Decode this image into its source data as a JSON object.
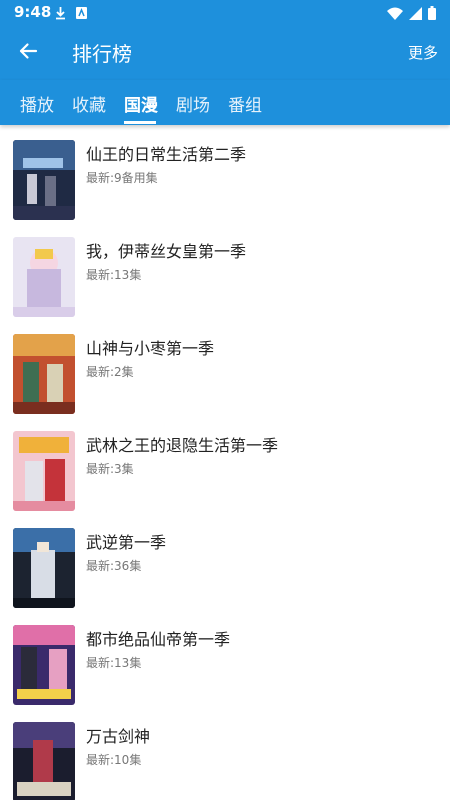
{
  "status": {
    "time": "9:48",
    "icons": [
      "download-icon",
      "app-icon",
      "wifi-icon",
      "signal-icon",
      "battery-icon"
    ]
  },
  "header": {
    "title": "排行榜",
    "more_label": "更多",
    "back_icon": "arrow-left-icon"
  },
  "tabs": [
    {
      "label": "播放"
    },
    {
      "label": "收藏"
    },
    {
      "label": "国漫",
      "active": true
    },
    {
      "label": "剧场"
    },
    {
      "label": "番组"
    }
  ],
  "items": [
    {
      "title": "仙王的日常生活第二季",
      "subtitle": "最新:9备用集"
    },
    {
      "title": "我，伊蒂丝女皇第一季",
      "subtitle": "最新:13集"
    },
    {
      "title": "山神与小枣第一季",
      "subtitle": "最新:2集"
    },
    {
      "title": "武林之王的退隐生活第一季",
      "subtitle": "最新:3集"
    },
    {
      "title": "武逆第一季",
      "subtitle": "最新:36集"
    },
    {
      "title": "都市绝品仙帝第一季",
      "subtitle": "最新:13集"
    },
    {
      "title": "万古剑神",
      "subtitle": "最新:10集"
    }
  ],
  "colors": {
    "primary": "#1e90dc",
    "title_text": "#222222",
    "sub_text": "#777777"
  }
}
